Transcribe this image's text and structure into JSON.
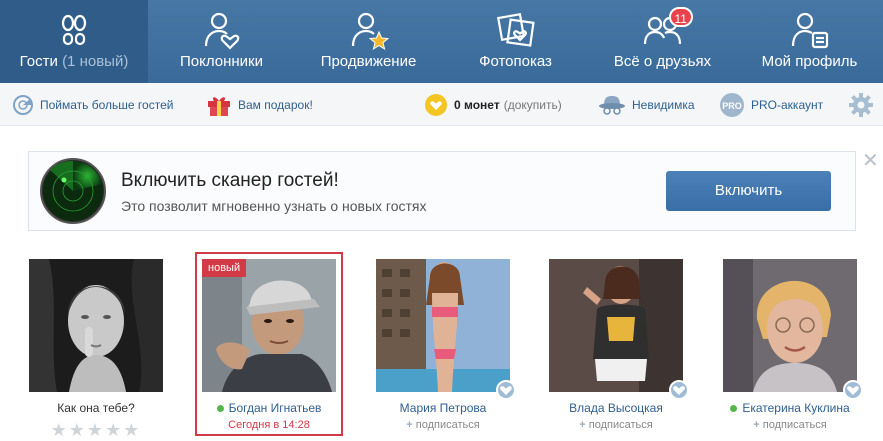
{
  "nav": {
    "guests_label": "Гости",
    "guests_new": "(1 новый)",
    "fans_label": "Поклонники",
    "promo_label": "Продвижение",
    "photoshow_label": "Фотопоказ",
    "friends_label": "Всё о друзьях",
    "friends_badge": "11",
    "profile_label": "Мой профиль"
  },
  "toolbar": {
    "catch_more": "Поймать больше гостей",
    "gift": "Вам подарок!",
    "coins": "0 монет",
    "buy": "(докупить)",
    "invisible": "Невидимка",
    "pro_badge": "PRO",
    "pro_account": "PRO-аккаунт"
  },
  "banner": {
    "title": "Включить сканер гостей!",
    "subtitle": "Это позволит мгновенно узнать о новых гостях",
    "button": "Включить",
    "close": "✕"
  },
  "cards": [
    {
      "name": "Как она тебе?",
      "stars": "★★★★★"
    },
    {
      "tag": "новый",
      "name": "Богдан Игнатьев",
      "time": "Сегодня в 14:28"
    },
    {
      "name": "Мария Петрова",
      "action": "подписаться"
    },
    {
      "name": "Влада Высоцкая",
      "action": "подписаться"
    },
    {
      "name": "Екатерина Куклина",
      "action": "подписаться"
    }
  ],
  "icons": {
    "guests": "footprints-icon",
    "fans": "person-heart-icon",
    "promo": "person-star-icon",
    "photoshow": "photos-heart-icon",
    "friends": "friends-heart-icon",
    "profile": "person-card-icon",
    "catch": "radar-icon",
    "gift": "gift-icon",
    "coin": "coin-icon",
    "invisible": "spy-hat-icon",
    "settings": "gear-icon"
  },
  "colors": {
    "nav_bg": "#3d6f9f",
    "nav_active": "#2f5c88",
    "badge": "#e8424d",
    "link": "#2f5f8f",
    "new_red": "#d23a47",
    "online": "#55b64a"
  }
}
